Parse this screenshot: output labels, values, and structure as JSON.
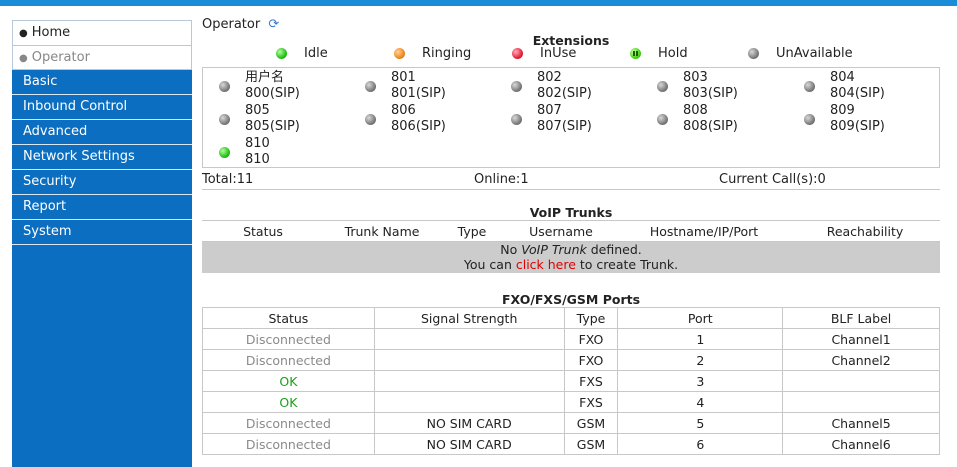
{
  "sidebar": {
    "sub_items": [
      {
        "label": "Home",
        "active": false
      },
      {
        "label": "Operator",
        "active": true
      }
    ],
    "items": [
      {
        "label": "Basic"
      },
      {
        "label": "Inbound Control"
      },
      {
        "label": "Advanced"
      },
      {
        "label": "Network Settings"
      },
      {
        "label": "Security"
      },
      {
        "label": "Report"
      },
      {
        "label": "System"
      }
    ]
  },
  "page": {
    "title": "Operator",
    "refresh_icon": "refresh-icon"
  },
  "extensions": {
    "title": "Extensions",
    "legend": [
      {
        "label": "Idle",
        "status": "green"
      },
      {
        "label": "Ringing",
        "status": "orange"
      },
      {
        "label": "InUse",
        "status": "red"
      },
      {
        "label": "Hold",
        "status": "hold"
      },
      {
        "label": "UnAvailable",
        "status": "gray"
      }
    ],
    "list": [
      {
        "name": "用户名",
        "number": "800(SIP)",
        "status": "gray"
      },
      {
        "name": "801",
        "number": "801(SIP)",
        "status": "gray"
      },
      {
        "name": "802",
        "number": "802(SIP)",
        "status": "gray"
      },
      {
        "name": "803",
        "number": "803(SIP)",
        "status": "gray"
      },
      {
        "name": "804",
        "number": "804(SIP)",
        "status": "gray"
      },
      {
        "name": "805",
        "number": "805(SIP)",
        "status": "gray"
      },
      {
        "name": "806",
        "number": "806(SIP)",
        "status": "gray"
      },
      {
        "name": "807",
        "number": "807(SIP)",
        "status": "gray"
      },
      {
        "name": "808",
        "number": "808(SIP)",
        "status": "gray"
      },
      {
        "name": "809",
        "number": "809(SIP)",
        "status": "gray"
      },
      {
        "name": "810",
        "number": "810",
        "status": "green"
      }
    ],
    "totals": {
      "total": "Total:11",
      "online": "Online:1",
      "current_calls": "Current Call(s):0"
    }
  },
  "voip": {
    "title": "VoIP Trunks",
    "headers": [
      "Status",
      "Trunk Name",
      "Type",
      "Username",
      "Hostname/IP/Port",
      "Reachability"
    ],
    "empty_prefix": "No ",
    "empty_em": "VoIP Trunk",
    "empty_suffix": " defined.",
    "create_prefix": "You can ",
    "create_link": "click here",
    "create_suffix": " to create Trunk."
  },
  "fxo": {
    "title": "FXO/FXS/GSM Ports",
    "headers": [
      "Status",
      "Signal Strength",
      "Type",
      "Port",
      "BLF Label"
    ],
    "rows": [
      {
        "status": "Disconnected",
        "state": "dis",
        "signal": "",
        "type": "FXO",
        "port": "1",
        "blf": "Channel1"
      },
      {
        "status": "Disconnected",
        "state": "dis",
        "signal": "",
        "type": "FXO",
        "port": "2",
        "blf": "Channel2"
      },
      {
        "status": "OK",
        "state": "ok",
        "signal": "",
        "type": "FXS",
        "port": "3",
        "blf": ""
      },
      {
        "status": "OK",
        "state": "ok",
        "signal": "",
        "type": "FXS",
        "port": "4",
        "blf": ""
      },
      {
        "status": "Disconnected",
        "state": "dis",
        "signal": "NO SIM CARD",
        "type": "GSM",
        "port": "5",
        "blf": "Channel5"
      },
      {
        "status": "Disconnected",
        "state": "dis",
        "signal": "NO SIM CARD",
        "type": "GSM",
        "port": "6",
        "blf": "Channel6"
      }
    ]
  }
}
